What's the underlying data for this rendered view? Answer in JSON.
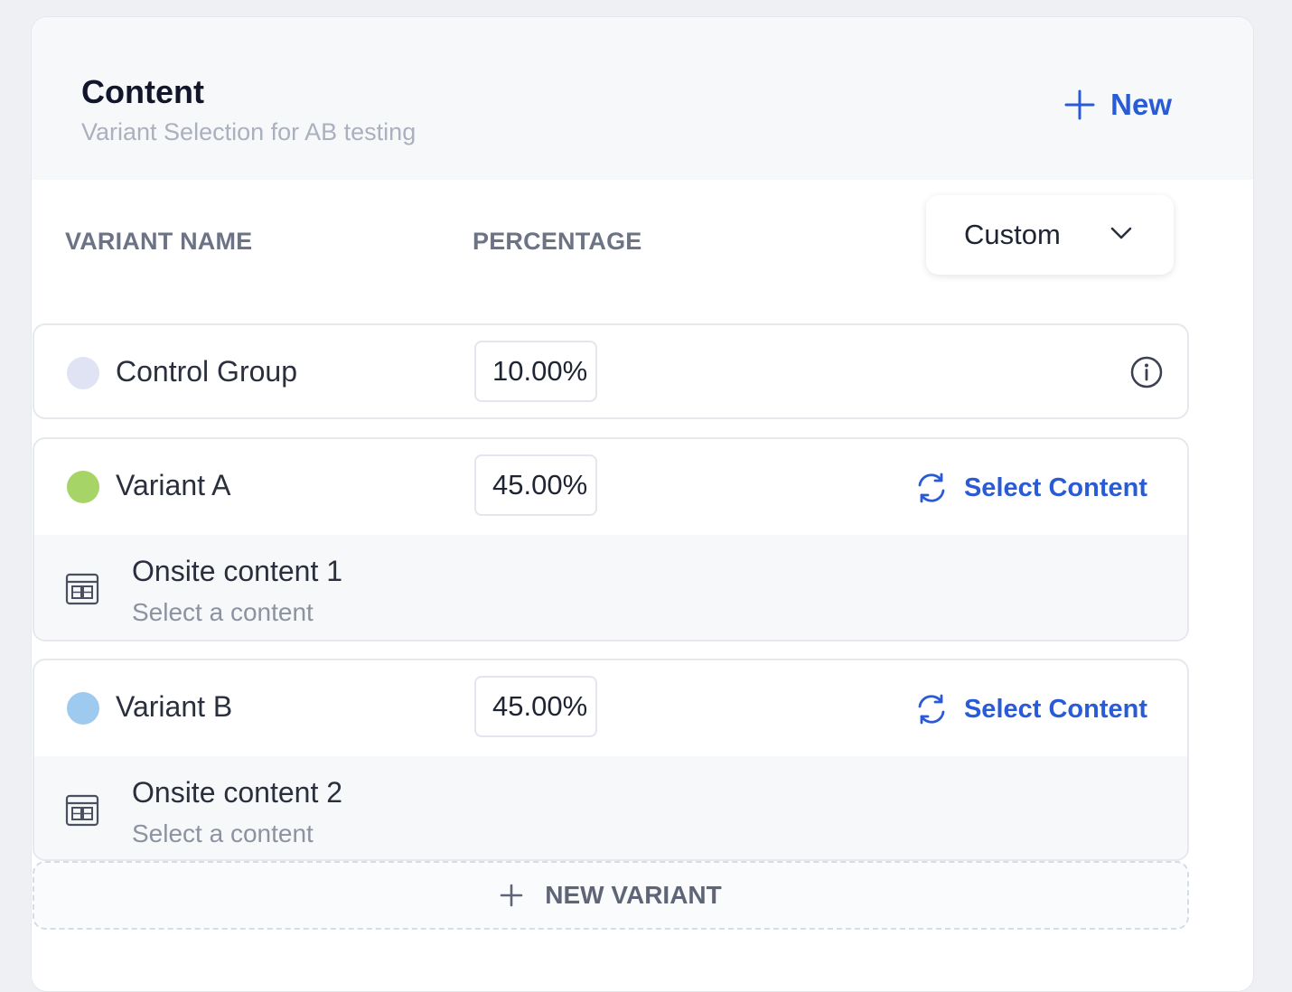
{
  "header": {
    "title": "Content",
    "subtitle": "Variant Selection for AB testing",
    "new_label": "New"
  },
  "columns": {
    "variant_name": "VARIANT NAME",
    "percentage": "PERCENTAGE"
  },
  "distribution": {
    "selected": "Custom"
  },
  "variants": [
    {
      "name": "Control Group",
      "percentage": "10.00%",
      "dot_color": "#dfe3f3"
    },
    {
      "name": "Variant A",
      "percentage": "45.00%",
      "dot_color": "#a7d466",
      "action_label": "Select Content",
      "content_title": "Onsite content 1",
      "content_sub": "Select a content"
    },
    {
      "name": "Variant B",
      "percentage": "45.00%",
      "dot_color": "#9fcaf0",
      "action_label": "Select Content",
      "content_title": "Onsite content 2",
      "content_sub": "Select a content"
    }
  ],
  "new_variant_label": "NEW VARIANT",
  "colors": {
    "accent": "#2a5bd7",
    "header_bg": "#f7f8fa",
    "page_bg": "#eef0f3"
  },
  "icons": [
    "plus-icon",
    "chevron-down-icon",
    "info-icon",
    "refresh-icon",
    "content-layout-icon"
  ]
}
